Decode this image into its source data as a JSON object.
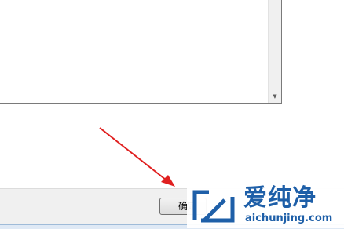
{
  "dialog": {
    "ok_button_label": "确定"
  },
  "watermark": {
    "title": "爱纯净",
    "url": "aichunjing.com",
    "color": "#1e5fa8"
  },
  "annotation": {
    "arrow_color": "#e02020"
  },
  "icons": {
    "scroll_down": "scroll-down-arrow-icon",
    "logo": "aichunjing-logo-icon"
  }
}
